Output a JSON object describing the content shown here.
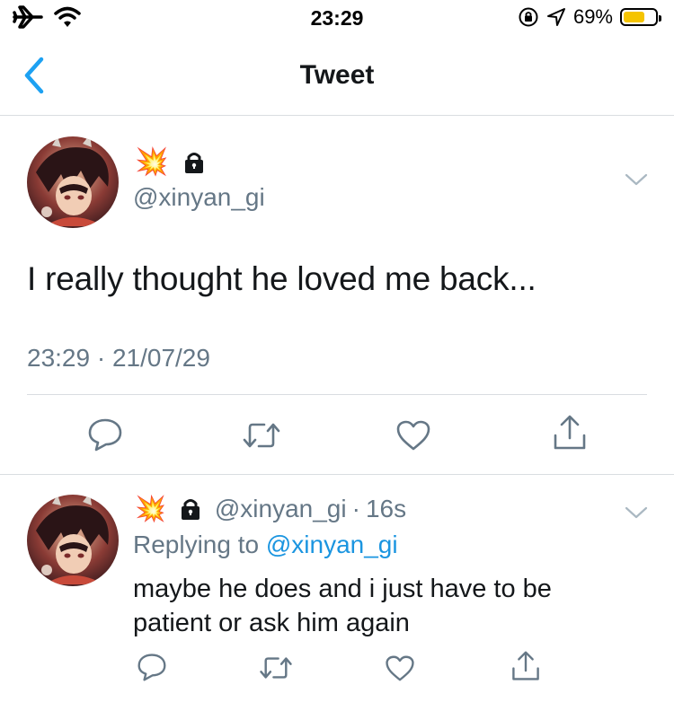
{
  "status_bar": {
    "time": "23:29",
    "battery_percent": "69%",
    "battery_level": 0.69,
    "battery_color": "#f5c400",
    "icons": [
      "airplane-icon",
      "wifi-icon",
      "rotation-lock-icon",
      "location-icon",
      "battery-icon"
    ]
  },
  "nav": {
    "title": "Tweet",
    "back_icon": "chevron-left-icon",
    "accent": "#1da1f2"
  },
  "tweet": {
    "display_name_emoji": "💥",
    "protected_icon": "lock-icon",
    "handle": "@xinyan_gi",
    "text": "I really thought he loved me back...",
    "timestamp": "23:29 · 21/07/29",
    "actions": [
      "reply-icon",
      "retweet-icon",
      "like-icon",
      "share-icon"
    ]
  },
  "reply": {
    "display_name_emoji": "💥",
    "protected_icon": "lock-icon",
    "handle": "@xinyan_gi",
    "dot": "·",
    "time_ago": "16s",
    "replying_prefix": "Replying to",
    "replying_to": "@xinyan_gi",
    "text": "maybe he does and i just have to be patient or ask him again",
    "actions": [
      "reply-icon",
      "retweet-icon",
      "like-icon",
      "share-icon"
    ]
  }
}
